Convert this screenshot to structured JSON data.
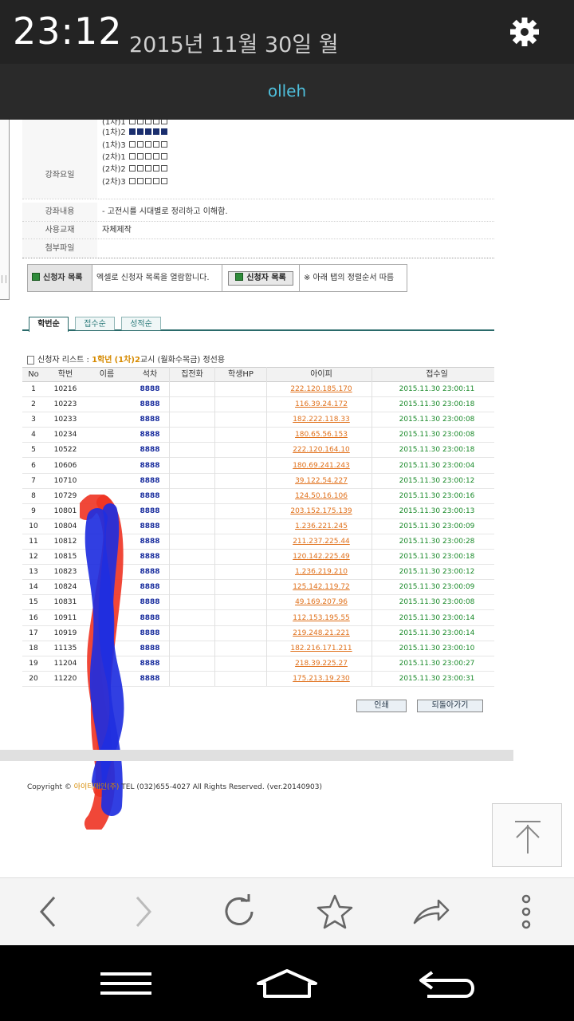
{
  "status": {
    "time": "23:12",
    "date": "2015년 11월 30일 월",
    "carrier": "olleh"
  },
  "info": {
    "schedule_label": "강좌요일",
    "periods": [
      {
        "label": "(1차)1",
        "filled": 0
      },
      {
        "label": "(1차)2",
        "filled": 5
      },
      {
        "label": "(1차)3",
        "filled": 0
      },
      {
        "label": "(2차)1",
        "filled": 0
      },
      {
        "label": "(2차)2",
        "filled": 0
      },
      {
        "label": "(2차)3",
        "filled": 0
      }
    ],
    "content_label": "강좌내용",
    "content_value": "- 고전시를 시대별로 정리하고 이해함.",
    "material_label": "사용교재",
    "material_value": "자체제작",
    "attachment_label": "첨부파일"
  },
  "toolbar": {
    "applicant_list_label": "신청자 목록",
    "excel_hint": "엑셀로 신청자 목록을 열람합니다.",
    "applicant_list_btn": "신청자 목록",
    "sort_note": "※ 아래 탭의 정렬순서 따름"
  },
  "tabs": [
    "학번순",
    "접수순",
    "성적순"
  ],
  "list_title": {
    "prefix": "신청자 리스트 : ",
    "grade": "1학년",
    "period": "(1차)2",
    "suffix": "교시 (월화수목금) 정선용"
  },
  "columns": [
    "No",
    "학번",
    "이름",
    "석차",
    "집전화",
    "학생HP",
    "아이피",
    "접수일"
  ],
  "rows": [
    {
      "no": "1",
      "id": "10216",
      "seat": "8888",
      "ip": "222.120.185.170",
      "time": "2015.11.30 23:00:11"
    },
    {
      "no": "2",
      "id": "10223",
      "seat": "8888",
      "ip": "116.39.24.172",
      "time": "2015.11.30 23:00:18"
    },
    {
      "no": "3",
      "id": "10233",
      "seat": "8888",
      "ip": "182.222.118.33",
      "time": "2015.11.30 23:00:08"
    },
    {
      "no": "4",
      "id": "10234",
      "seat": "8888",
      "ip": "180.65.56.153",
      "time": "2015.11.30 23:00:08"
    },
    {
      "no": "5",
      "id": "10522",
      "seat": "8888",
      "ip": "222.120.164.10",
      "time": "2015.11.30 23:00:18"
    },
    {
      "no": "6",
      "id": "10606",
      "seat": "8888",
      "ip": "180.69.241.243",
      "time": "2015.11.30 23:00:04"
    },
    {
      "no": "7",
      "id": "10710",
      "seat": "8888",
      "ip": "39.122.54.227",
      "time": "2015.11.30 23:00:12"
    },
    {
      "no": "8",
      "id": "10729",
      "seat": "8888",
      "ip": "124.50.16.106",
      "time": "2015.11.30 23:00:16"
    },
    {
      "no": "9",
      "id": "10801",
      "seat": "8888",
      "ip": "203.152.175.139",
      "time": "2015.11.30 23:00:13"
    },
    {
      "no": "10",
      "id": "10804",
      "seat": "8888",
      "ip": "1.236.221.245",
      "time": "2015.11.30 23:00:09"
    },
    {
      "no": "11",
      "id": "10812",
      "seat": "8888",
      "ip": "211.237.225.44",
      "time": "2015.11.30 23:00:28"
    },
    {
      "no": "12",
      "id": "10815",
      "seat": "8888",
      "ip": "120.142.225.49",
      "time": "2015.11.30 23:00:18"
    },
    {
      "no": "13",
      "id": "10823",
      "seat": "8888",
      "ip": "1.236.219.210",
      "time": "2015.11.30 23:00:12"
    },
    {
      "no": "14",
      "id": "10824",
      "seat": "8888",
      "ip": "125.142.119.72",
      "time": "2015.11.30 23:00:09"
    },
    {
      "no": "15",
      "id": "10831",
      "seat": "8888",
      "ip": "49.169.207.96",
      "time": "2015.11.30 23:00:08"
    },
    {
      "no": "16",
      "id": "10911",
      "seat": "8888",
      "ip": "112.153.195.55",
      "time": "2015.11.30 23:00:14"
    },
    {
      "no": "17",
      "id": "10919",
      "seat": "8888",
      "ip": "219.248.21.221",
      "time": "2015.11.30 23:00:14"
    },
    {
      "no": "18",
      "id": "11135",
      "seat": "8888",
      "ip": "182.216.171.211",
      "time": "2015.11.30 23:00:10"
    },
    {
      "no": "19",
      "id": "11204",
      "seat": "8888",
      "ip": "218.39.225.27",
      "time": "2015.11.30 23:00:27"
    },
    {
      "no": "20",
      "id": "11220",
      "seat": "8888",
      "ip": "175.213.19.230",
      "time": "2015.11.30 23:00:31"
    }
  ],
  "buttons": {
    "print": "인쇄",
    "back": "되돌아가기"
  },
  "copyright": {
    "prefix": "Copyright © ",
    "brand": "아이티매인(주)",
    "suffix": " TEL (032)655-4027 All Rights Reserved. (ver.20140903)"
  },
  "icons": [
    "gear-icon",
    "back-icon",
    "forward-icon",
    "reload-icon",
    "star-icon",
    "share-icon",
    "more-icon",
    "menu-icon",
    "home-icon",
    "return-icon",
    "scroll-top-icon"
  ]
}
